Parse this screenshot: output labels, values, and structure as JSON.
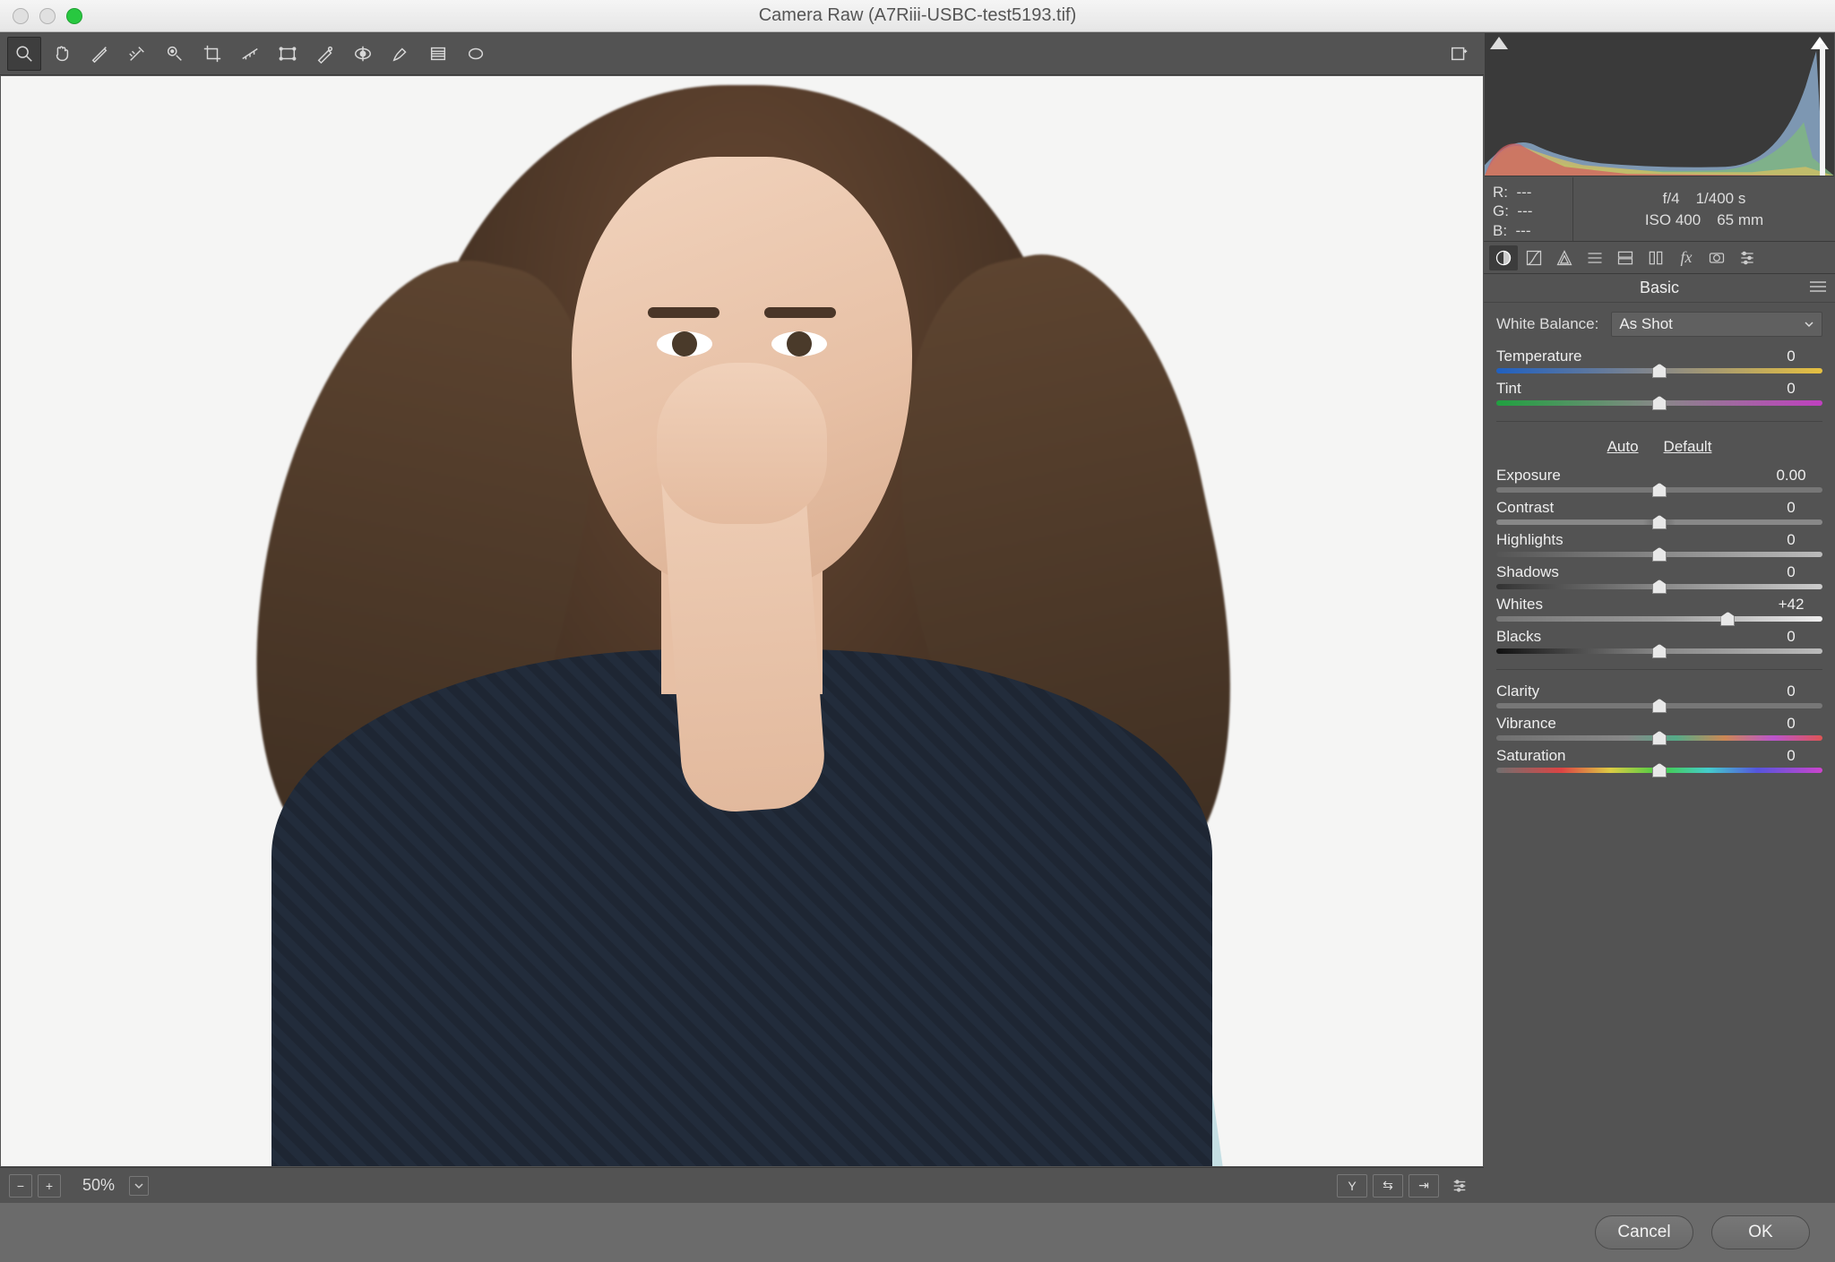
{
  "window": {
    "title": "Camera Raw (A7Riii-USBC-test5193.tif)"
  },
  "preview": {
    "zoom": "50%"
  },
  "exif": {
    "r": "R:",
    "r_val": "---",
    "g": "G:",
    "g_val": "---",
    "b": "B:",
    "b_val": "---",
    "aperture": "f/4",
    "shutter": "1/400 s",
    "iso": "ISO 400",
    "focal": "65 mm"
  },
  "panel": {
    "title": "Basic",
    "wb_label": "White Balance:",
    "wb_value": "As Shot",
    "auto": "Auto",
    "default": "Default",
    "sliders": {
      "temperature": {
        "label": "Temperature",
        "value": "0",
        "pos": 50
      },
      "tint": {
        "label": "Tint",
        "value": "0",
        "pos": 50
      },
      "exposure": {
        "label": "Exposure",
        "value": "0.00",
        "pos": 50
      },
      "contrast": {
        "label": "Contrast",
        "value": "0",
        "pos": 50
      },
      "highlights": {
        "label": "Highlights",
        "value": "0",
        "pos": 50
      },
      "shadows": {
        "label": "Shadows",
        "value": "0",
        "pos": 50
      },
      "whites": {
        "label": "Whites",
        "value": "+42",
        "pos": 71
      },
      "blacks": {
        "label": "Blacks",
        "value": "0",
        "pos": 50
      },
      "clarity": {
        "label": "Clarity",
        "value": "0",
        "pos": 50
      },
      "vibrance": {
        "label": "Vibrance",
        "value": "0",
        "pos": 50
      },
      "saturation": {
        "label": "Saturation",
        "value": "0",
        "pos": 50
      }
    }
  },
  "footer": {
    "cancel": "Cancel",
    "ok": "OK"
  }
}
